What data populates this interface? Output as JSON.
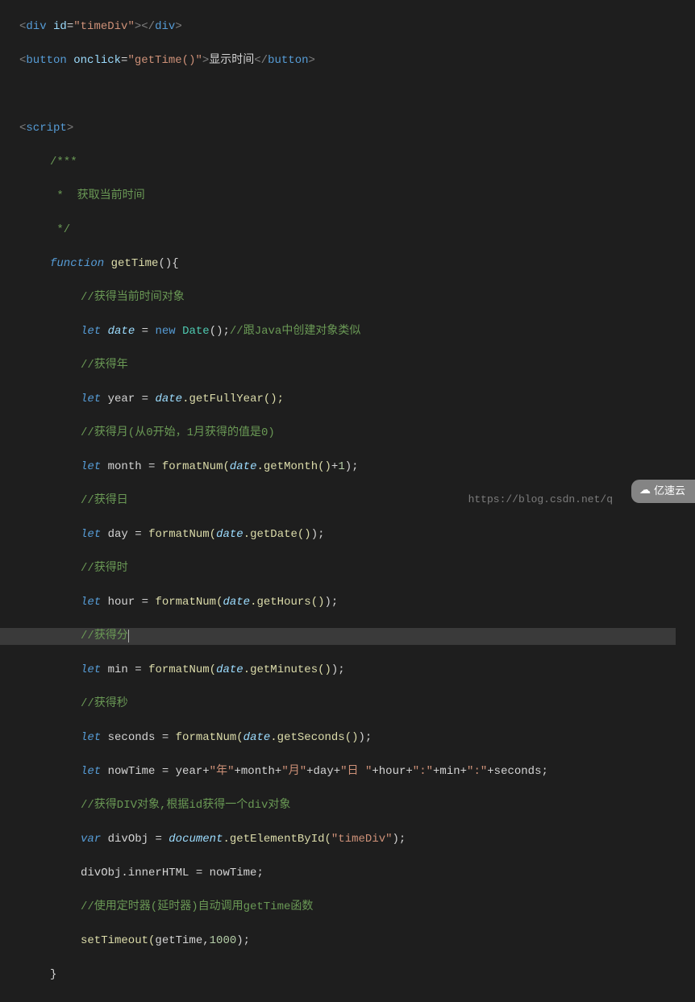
{
  "code": {
    "l1": {
      "tag_open": "div",
      "attr1_name": "id",
      "attr1_val": "\"timeDiv\"",
      "tag_close": "div"
    },
    "l2": {
      "tag_open": "button",
      "attr1_name": "onclick",
      "attr1_val": "\"getTime()\"",
      "text": "显示时间",
      "tag_close": "button"
    },
    "l3": "",
    "l4": {
      "tag": "script"
    },
    "l5": "/***",
    "l6": " *  获取当前时间",
    "l7": " */",
    "l8": {
      "kw": "function",
      "name": "getTime",
      "paren": "(){"
    },
    "l9": "//获得当前时间对象",
    "l10": {
      "kw": "let",
      "var": "date",
      "eq": " = ",
      "new": "new",
      "cls": " Date",
      "paren": "();",
      "cmt": "//跟Java中创建对象类似"
    },
    "l11": "//获得年",
    "l12": {
      "kw": "let",
      "var": "year",
      "eq": " = ",
      "obj": "date",
      "method": ".getFullYear();"
    },
    "l13": "//获得月(从0开始，1月获得的值是0)",
    "l14": {
      "kw": "let",
      "var": "month",
      "eq": " = ",
      "fn": "formatNum(",
      "obj": "date",
      "method": ".getMonth()",
      "plus": "+",
      "num": "1",
      "close": ");"
    },
    "l15": "//获得日",
    "l16": {
      "kw": "let",
      "var": "day",
      "eq": " = ",
      "fn": "formatNum(",
      "obj": "date",
      "method": ".getDate()",
      "close": ");"
    },
    "l17": "//获得时",
    "l18": {
      "kw": "let",
      "var": "hour",
      "eq": " = ",
      "fn": "formatNum(",
      "obj": "date",
      "method": ".getHours()",
      "close": ");"
    },
    "l19": "//获得分",
    "l20": {
      "kw": "let",
      "var": "min",
      "eq": " = ",
      "fn": "formatNum(",
      "obj": "date",
      "method": ".getMinutes()",
      "close": ");"
    },
    "l21": "//获得秒",
    "l22": {
      "kw": "let",
      "var": "seconds",
      "eq": " = ",
      "fn": "formatNum(",
      "obj": "date",
      "method": ".getSeconds()",
      "close": ");"
    },
    "l23": {
      "kw": "let",
      "var": "nowTime",
      "eq": " = ",
      "parts": [
        {
          "t": "v",
          "v": "year"
        },
        {
          "t": "op",
          "v": "+"
        },
        {
          "t": "s",
          "v": "\"年\""
        },
        {
          "t": "op",
          "v": "+"
        },
        {
          "t": "v",
          "v": "month"
        },
        {
          "t": "op",
          "v": "+"
        },
        {
          "t": "s",
          "v": "\"月\""
        },
        {
          "t": "op",
          "v": "+"
        },
        {
          "t": "v",
          "v": "day"
        },
        {
          "t": "op",
          "v": "+"
        },
        {
          "t": "s",
          "v": "\"日 \""
        },
        {
          "t": "op",
          "v": "+"
        },
        {
          "t": "v",
          "v": "hour"
        },
        {
          "t": "op",
          "v": "+"
        },
        {
          "t": "s",
          "v": "\":\""
        },
        {
          "t": "op",
          "v": "+"
        },
        {
          "t": "v",
          "v": "min"
        },
        {
          "t": "op",
          "v": "+"
        },
        {
          "t": "s",
          "v": "\":\""
        },
        {
          "t": "op",
          "v": "+"
        },
        {
          "t": "v",
          "v": "seconds"
        },
        {
          "t": "p",
          "v": ";"
        }
      ]
    },
    "l24": "//获得DIV对象,根据id获得一个div对象",
    "l25": {
      "kw": "var",
      "var": "divObj",
      "eq": " = ",
      "doc": "document",
      "method": ".getElementById(",
      "str": "\"timeDiv\"",
      "close": ");"
    },
    "l26": {
      "lhs": "divObj.innerHTML",
      "eq": " = ",
      "rhs": "nowTime;"
    },
    "l27": "//使用定时器(延时器)自动调用getTime函数",
    "l28": {
      "fn": "setTimeout(",
      "arg1": "getTime,",
      "num": "1000",
      "close": ");"
    },
    "l29": "}"
  },
  "footer_url": "https://blog.csdn.net/q",
  "watermark": "亿速云"
}
